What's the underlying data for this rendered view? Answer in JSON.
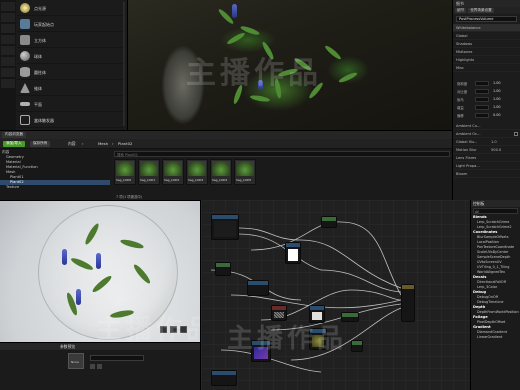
{
  "place_panel": {
    "items": [
      {
        "label": "点光源",
        "icon": "point-light-icon"
      },
      {
        "label": "玩家起始点",
        "icon": "player-start-icon"
      },
      {
        "label": "立方体",
        "icon": "cube-icon"
      },
      {
        "label": "球体",
        "icon": "sphere-icon"
      },
      {
        "label": "圆柱体",
        "icon": "cylinder-icon"
      },
      {
        "label": "锥体",
        "icon": "cone-icon"
      },
      {
        "label": "平面",
        "icon": "plane-icon"
      },
      {
        "label": "盒体触发器",
        "icon": "box-trigger-icon"
      },
      {
        "label": "球体触发器",
        "icon": "sphere-trigger-icon"
      }
    ]
  },
  "watermark": {
    "text": "主播作品"
  },
  "outliner": {
    "title": "细节",
    "tabs": [
      "细节",
      "世界场景设置"
    ],
    "name_value": "PostProcessVolume",
    "rows": [
      "Whitebalance",
      "Global",
      "Shadows",
      "Midtones",
      "Highlights",
      "Misc"
    ],
    "color_rows": [
      {
        "label": "饱和度",
        "value": "1.00"
      },
      {
        "label": "对比度",
        "value": "1.00"
      },
      {
        "label": "伽马",
        "value": "1.00"
      },
      {
        "label": "增益",
        "value": "1.00"
      },
      {
        "label": "偏移",
        "value": "0.00"
      }
    ],
    "lower_rows": [
      "Ambient Cu...",
      "Ambient Oc...",
      "Global Illu...",
      "Motion Blur",
      "Lens Flares",
      "Light Propa...",
      "Bloom"
    ],
    "lower_values": [
      "1.0",
      "500.0"
    ]
  },
  "content_browser": {
    "tab": "内容浏览器",
    "add_button": "添加/导入",
    "save_button": "保存所有",
    "breadcrumb": [
      "内容",
      "Mesh",
      "Plant02"
    ],
    "filter_placeholder": "搜索 Plant02",
    "tree": [
      "内容",
      "Geometry",
      "Material",
      "Material_Function",
      "Mesh",
      "Plant01",
      "Plant02",
      "Texture"
    ],
    "selected_tree": "Plant02",
    "assets": [
      "Veg_LOD0",
      "Veg_LOD1",
      "Veg_LOD2",
      "Veg_LOD3",
      "Veg_LOD4",
      "Veg_LOD5"
    ],
    "count": "7 项(1 项被选中)"
  },
  "mat_details": {
    "title": "参数预览",
    "texture_label": "None"
  },
  "palette": {
    "title": "控制板",
    "tab_all": "All",
    "sections": [
      {
        "label": "Blends",
        "items": [
          "Lerp_ScratchGrime",
          "Lerp_ScratchGrime2"
        ]
      },
      {
        "label": "Coordinates",
        "items": [
          "BlurSampleOffsets",
          "LocalPosition",
          "PanTextureCoordinate",
          "ScaleUVsByCenter",
          "SampleSceneDepth",
          "UVtoScreenUV",
          "UVTiling_0_1_Tiling",
          "WorldAlignedTex"
        ]
      },
      {
        "label": "Decals",
        "items": [
          "DirectionalFallOff",
          "Lerp_3Color"
        ]
      },
      {
        "label": "Debug",
        "items": [
          "DebugOnOff",
          "DebugTimeLine"
        ]
      },
      {
        "label": "Depth",
        "items": [
          "DepthFromWorldPosition"
        ]
      },
      {
        "label": "Foliage",
        "items": [
          "PixelDepthOffset"
        ]
      },
      {
        "label": "Gradient",
        "items": [
          "DiamondGradient",
          "LinearGradient"
        ]
      }
    ]
  }
}
